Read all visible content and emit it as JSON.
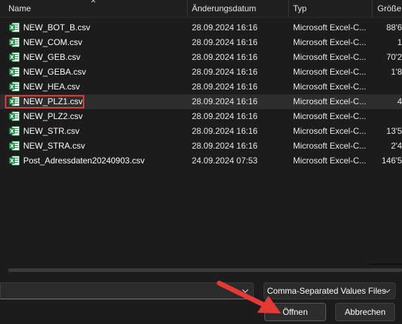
{
  "header": {
    "name": "Name",
    "date": "Änderungsdatum",
    "type": "Typ",
    "size": "Größe"
  },
  "files": [
    {
      "name": "NEW_BOT_B.csv",
      "date": "28.09.2024 16:16",
      "type": "Microsoft Excel-C...",
      "size": "88'6"
    },
    {
      "name": "NEW_COM.csv",
      "date": "28.09.2024 16:16",
      "type": "Microsoft Excel-C...",
      "size": "1"
    },
    {
      "name": "NEW_GEB.csv",
      "date": "28.09.2024 16:16",
      "type": "Microsoft Excel-C...",
      "size": "70'2"
    },
    {
      "name": "NEW_GEBA.csv",
      "date": "28.09.2024 16:16",
      "type": "Microsoft Excel-C...",
      "size": "1'8"
    },
    {
      "name": "NEW_HEA.csv",
      "date": "28.09.2024 16:16",
      "type": "Microsoft Excel-C...",
      "size": ""
    },
    {
      "name": "NEW_PLZ1.csv",
      "date": "28.09.2024 16:16",
      "type": "Microsoft Excel-C...",
      "size": "4",
      "selected": true
    },
    {
      "name": "NEW_PLZ2.csv",
      "date": "28.09.2024 16:16",
      "type": "Microsoft Excel-C...",
      "size": ""
    },
    {
      "name": "NEW_STR.csv",
      "date": "28.09.2024 16:16",
      "type": "Microsoft Excel-C...",
      "size": "13'5"
    },
    {
      "name": "NEW_STRA.csv",
      "date": "28.09.2024 16:16",
      "type": "Microsoft Excel-C...",
      "size": "2'4"
    },
    {
      "name": "Post_Adressdaten20240903.csv",
      "date": "24.09.2024 07:53",
      "type": "Microsoft Excel-C...",
      "size": "146'5"
    }
  ],
  "filename_input": {
    "value": ""
  },
  "filter": {
    "selected": "Comma-Separated Values Files"
  },
  "buttons": {
    "open": "Öffnen",
    "cancel": "Abbrechen"
  },
  "colors": {
    "excel_green": "#1d8a45",
    "highlight": "#e53935"
  }
}
